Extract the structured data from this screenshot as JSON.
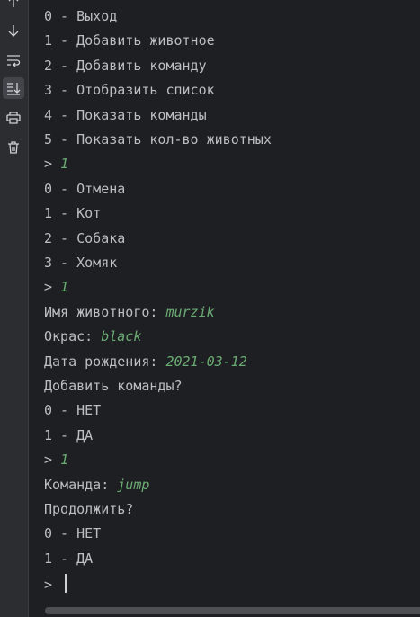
{
  "toolbar": {
    "tools": [
      {
        "icon": "up-arrow-icon"
      },
      {
        "icon": "down-arrow-icon"
      },
      {
        "icon": "soft-wrap-icon"
      },
      {
        "icon": "scroll-to-end-icon",
        "active": true
      },
      {
        "icon": "print-icon"
      },
      {
        "icon": "trash-icon"
      }
    ]
  },
  "console": {
    "lines": [
      {
        "text": "0 - Выход"
      },
      {
        "text": "1 - Добавить животное"
      },
      {
        "text": "2 - Добавить команду"
      },
      {
        "text": "3 - Отобразить список"
      },
      {
        "text": "4 - Показать команды"
      },
      {
        "text": "5 - Показать кол-во животных"
      },
      {
        "prompt": "> ",
        "input": "1"
      },
      {
        "text": "0 - Отмена"
      },
      {
        "text": "1 - Кот"
      },
      {
        "text": "2 - Собака"
      },
      {
        "text": "3 - Хомяк"
      },
      {
        "prompt": "> ",
        "input": "1"
      },
      {
        "prompt": "Имя животного: ",
        "input": "murzik"
      },
      {
        "prompt": "Окрас: ",
        "input": "black"
      },
      {
        "prompt": "Дата рождения: ",
        "input": "2021-03-12"
      },
      {
        "text": "Добавить команды?"
      },
      {
        "text": "0 - НЕТ"
      },
      {
        "text": "1 - ДА"
      },
      {
        "prompt": "> ",
        "input": "1"
      },
      {
        "prompt": "Команда: ",
        "input": "jump"
      },
      {
        "text": "Продолжить?"
      },
      {
        "text": "0 - НЕТ"
      },
      {
        "text": "1 - ДА"
      },
      {
        "prompt": "> ",
        "input": "",
        "cursor": true
      }
    ]
  },
  "colors": {
    "background": "#1e1f22",
    "toolbar": "#2b2d30",
    "text": "#bcbec4",
    "user_input": "#6aab73",
    "icon": "#ced0d6"
  }
}
